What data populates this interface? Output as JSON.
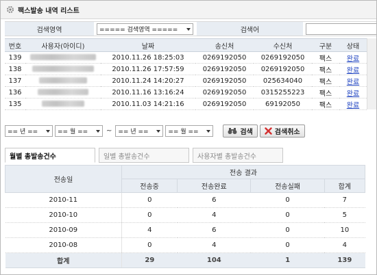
{
  "header": {
    "title": "팩스발송 내역 리스트",
    "icon": "gear-icon"
  },
  "search": {
    "area_label": "검색영역",
    "area_select": "===== 검색영역 =====",
    "keyword_label": "검색어",
    "keyword_value": ""
  },
  "list": {
    "columns": [
      "번호",
      "사용자(아이디)",
      "날짜",
      "송신처",
      "수신처",
      "구분",
      "상태"
    ],
    "rows": [
      {
        "no": "139",
        "date": "2010.11.26 18:25:03",
        "sender": "0269192050",
        "receiver": "0269192050",
        "type": "팩스",
        "status": "완료"
      },
      {
        "no": "138",
        "date": "2010.11.26 17:57:59",
        "sender": "0269192050",
        "receiver": "0269192050",
        "type": "팩스",
        "status": "완료"
      },
      {
        "no": "137",
        "date": "2010.11.24 14:20:27",
        "sender": "0269192050",
        "receiver": "025634040",
        "type": "팩스",
        "status": "완료"
      },
      {
        "no": "136",
        "date": "2010.11.16 13:16:24",
        "sender": "0269192050",
        "receiver": "0315255223",
        "type": "팩스",
        "status": "완료"
      },
      {
        "no": "135",
        "date": "2010.11.03 14:21:16",
        "sender": "0269192050",
        "receiver": "69192050",
        "type": "팩스",
        "status": "완료"
      }
    ]
  },
  "filter": {
    "year_from": "== 년 ==",
    "month_from": "== 월 ==",
    "tilde": "~",
    "year_to": "== 년 ==",
    "month_to": "== 월 ==",
    "search_button": "검색",
    "cancel_button": "검색취소"
  },
  "tabs": [
    "월별 총발송건수",
    "일별 총발송건수",
    "사용자별 총발송건수"
  ],
  "summary": {
    "col_date": "전송일",
    "group_header": "전송 결과",
    "sub_cols": [
      "전송중",
      "전송완료",
      "전송실패",
      "합계"
    ],
    "rows": [
      {
        "date": "2010-11",
        "sending": "0",
        "done": "6",
        "failed": "0",
        "total": "7"
      },
      {
        "date": "2010-10",
        "sending": "0",
        "done": "4",
        "failed": "0",
        "total": "5"
      },
      {
        "date": "2010-09",
        "sending": "4",
        "done": "6",
        "failed": "0",
        "total": "10"
      },
      {
        "date": "2010-08",
        "sending": "0",
        "done": "4",
        "failed": "0",
        "total": "4"
      }
    ],
    "total": {
      "label": "합계",
      "sending": "29",
      "done": "104",
      "failed": "1",
      "total": "139"
    }
  },
  "colors": {
    "header_bg": "#e8edf3",
    "link": "#1a3fbf",
    "cancel_icon": "#d32f2f"
  }
}
